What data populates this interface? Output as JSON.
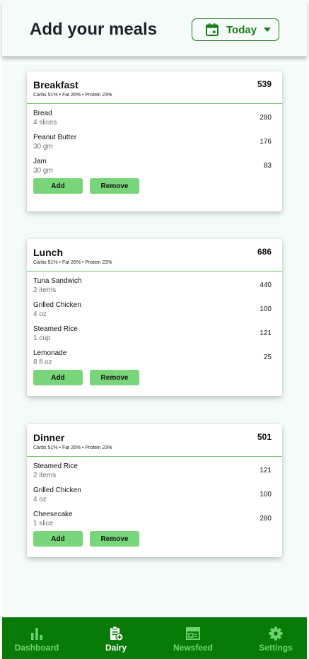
{
  "header": {
    "title": "Add your meals",
    "date_label": "Today",
    "date_icon": "calendar-icon",
    "date_caret_icon": "caret-down-icon"
  },
  "meals": [
    {
      "title": "Breakfast",
      "total": "539",
      "macros": "Carbs 51% • Fat 26% • Protein 23%",
      "items": [
        {
          "name": "Bread",
          "qty": "4 slices",
          "cal": "280"
        },
        {
          "name": "Peanut Butter",
          "qty": "30 gm",
          "cal": "176"
        },
        {
          "name": "Jam",
          "qty": "30 gm",
          "cal": "83"
        }
      ],
      "add_label": "Add",
      "remove_label": "Remove"
    },
    {
      "title": "Lunch",
      "total": "686",
      "macros": "Carbs 51% • Fat 26% • Protein 23%",
      "items": [
        {
          "name": "Tuna Sandwich",
          "qty": "2 items",
          "cal": "440"
        },
        {
          "name": "Grilled Chicken",
          "qty": "4 oz",
          "cal": "100"
        },
        {
          "name": "Steamed Rice",
          "qty": "1 cup",
          "cal": "121"
        },
        {
          "name": "Lemonade",
          "qty": "8 fl oz",
          "cal": "25"
        }
      ],
      "add_label": "Add",
      "remove_label": "Remove"
    },
    {
      "title": "Dinner",
      "total": "501",
      "macros": "Carbs 51% • Fat 26% • Protein 23%",
      "items": [
        {
          "name": "Steamed Rice",
          "qty": "2 items",
          "cal": "121"
        },
        {
          "name": "Grilled Chicken",
          "qty": "4 oz",
          "cal": "100"
        },
        {
          "name": "Cheesecake",
          "qty": "1 slice",
          "cal": "280"
        }
      ],
      "add_label": "Add",
      "remove_label": "Remove"
    }
  ],
  "nav": {
    "items": [
      {
        "label": "Dashboard",
        "icon": "bar-chart-icon",
        "active": false
      },
      {
        "label": "Dairy",
        "icon": "clipboard-add-icon",
        "active": true
      },
      {
        "label": "Newsfeed",
        "icon": "newspaper-icon",
        "active": false
      },
      {
        "label": "Settings",
        "icon": "gear-icon",
        "active": false
      }
    ]
  },
  "colors": {
    "accent": "#1e7b1e",
    "nav_bg": "#087a08",
    "nav_inactive": "#6fd46f",
    "button_bg": "#79d579",
    "divider": "#6cc46c",
    "background": "#f4fbf8"
  }
}
